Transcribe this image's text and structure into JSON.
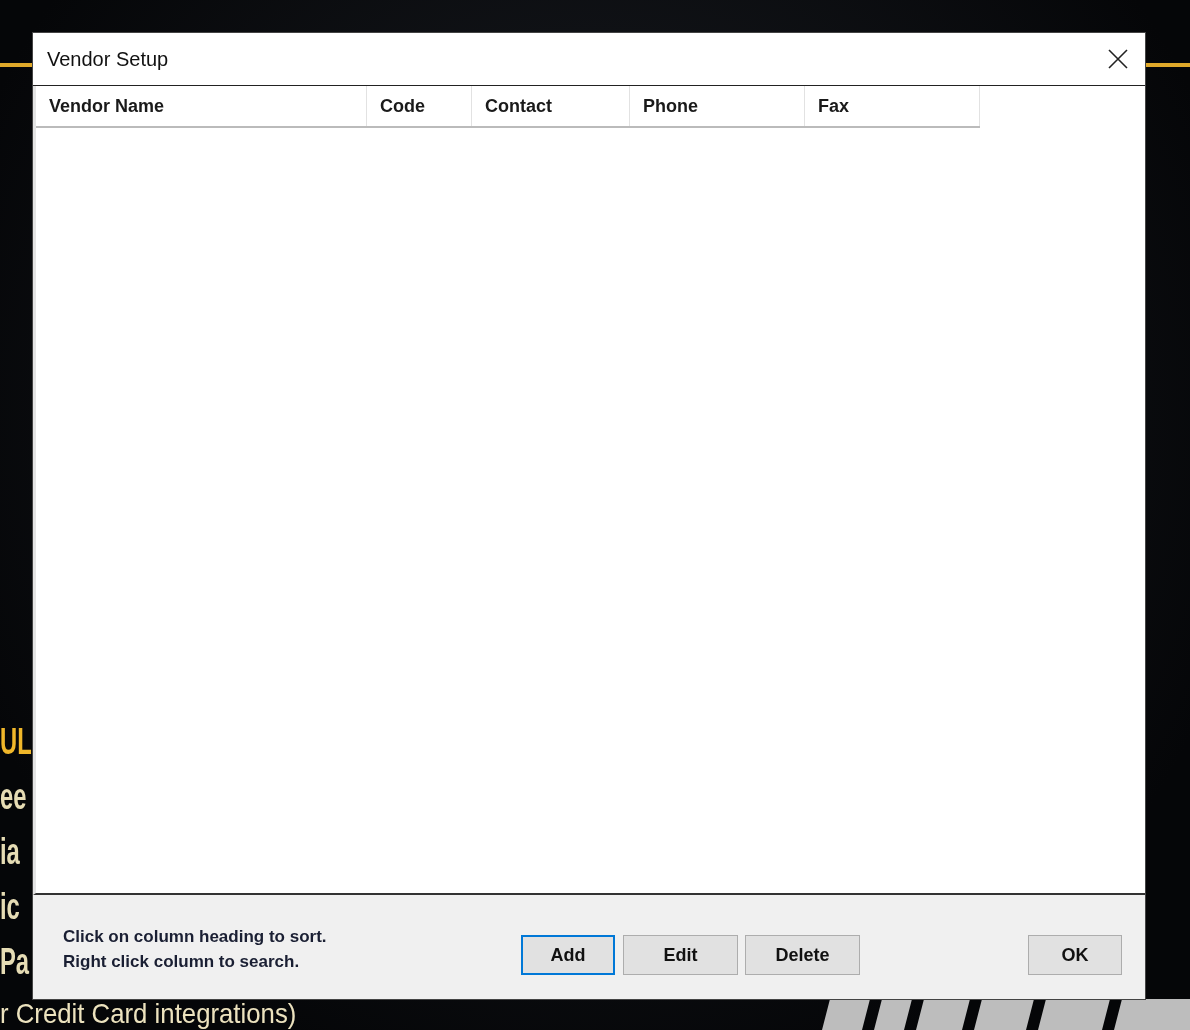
{
  "background": {
    "fragments": [
      {
        "text": "UL",
        "kind": "heading"
      },
      {
        "text": "ee",
        "kind": "line"
      },
      {
        "text": "ia",
        "kind": "line"
      },
      {
        "text": "ic",
        "kind": "line"
      },
      {
        "text": "Pa",
        "kind": "line"
      }
    ],
    "bottom_line": "r Credit Card integrations)"
  },
  "window": {
    "title": "Vendor Setup"
  },
  "table": {
    "columns": [
      "Vendor Name",
      "Code",
      "Contact",
      "Phone",
      "Fax"
    ]
  },
  "hint_lines": [
    "Click on column heading to sort.",
    "Right click column to search."
  ],
  "buttons": [
    {
      "label": "Add",
      "default": true
    },
    {
      "label": "Edit",
      "default": false
    },
    {
      "label": "Delete",
      "default": false
    }
  ],
  "ok_button": {
    "label": "OK"
  }
}
